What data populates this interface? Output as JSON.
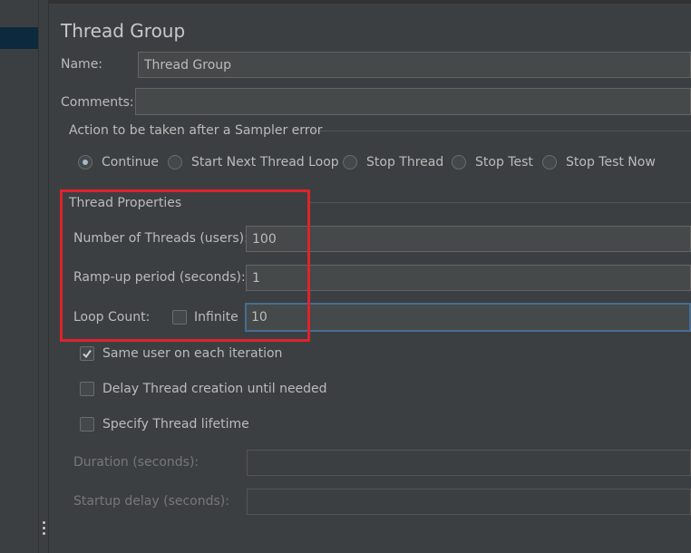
{
  "panel": {
    "title": "Thread Group"
  },
  "name_field": {
    "label": "Name:",
    "value": "Thread Group"
  },
  "comments_field": {
    "label": "Comments:",
    "value": ""
  },
  "sampler_error": {
    "legend": "Action to be taken after a Sampler error",
    "options": [
      {
        "label": "Continue",
        "checked": true
      },
      {
        "label": "Start Next Thread Loop",
        "checked": false
      },
      {
        "label": "Stop Thread",
        "checked": false
      },
      {
        "label": "Stop Test",
        "checked": false
      },
      {
        "label": "Stop Test Now",
        "checked": false
      }
    ]
  },
  "thread_properties": {
    "legend": "Thread Properties",
    "threads": {
      "label": "Number of Threads (users):",
      "value": "100"
    },
    "rampup": {
      "label": "Ramp-up period (seconds):",
      "value": "1"
    },
    "loop": {
      "label": "Loop Count:",
      "infinite_label": "Infinite",
      "infinite_checked": false,
      "value": "10"
    }
  },
  "options": {
    "same_user": {
      "label": "Same user on each iteration",
      "checked": true
    },
    "delay_creation": {
      "label": "Delay Thread creation until needed",
      "checked": false
    },
    "specify_lifetime": {
      "label": "Specify Thread lifetime",
      "checked": false
    }
  },
  "lifetime": {
    "duration": {
      "label": "Duration (seconds):",
      "value": ""
    },
    "startup_delay": {
      "label": "Startup delay (seconds):",
      "value": ""
    }
  },
  "colors": {
    "background": "#3c3f41",
    "field_background": "#45494a",
    "focus_border": "#466d94",
    "highlight_annotation": "#e0232b",
    "tree_selection": "#0d293e"
  }
}
